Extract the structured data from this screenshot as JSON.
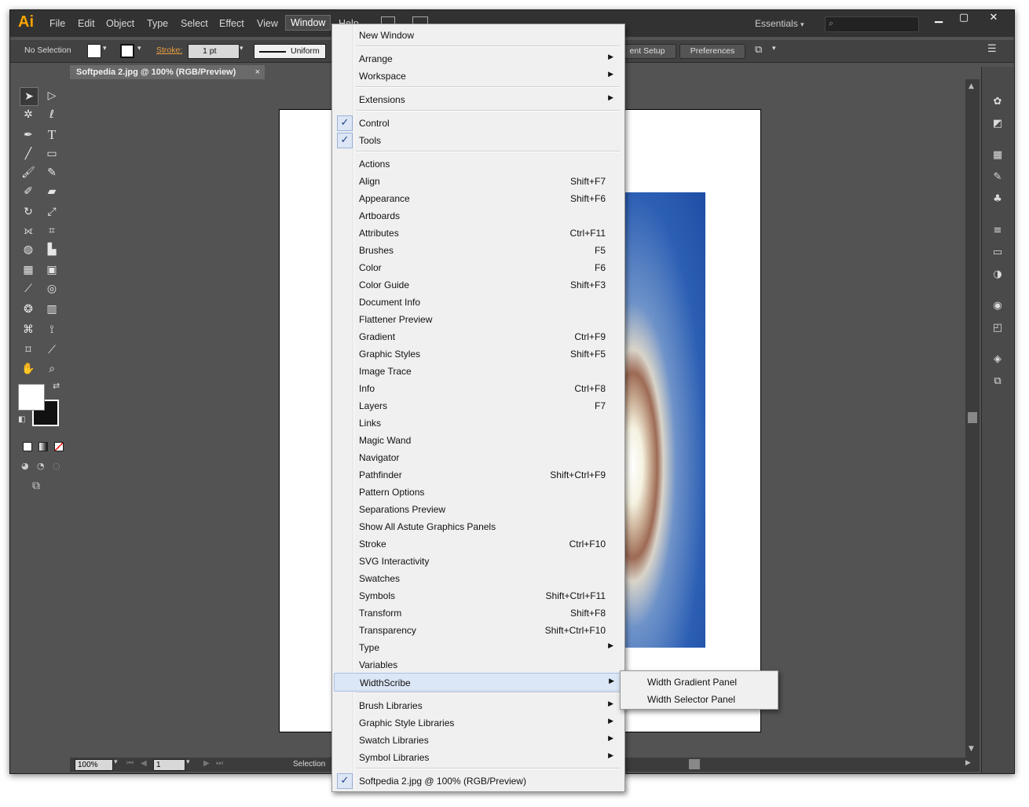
{
  "menubar": {
    "logo": "Ai",
    "items": [
      "File",
      "Edit",
      "Object",
      "Type",
      "Select",
      "Effect",
      "View",
      "Window",
      "Help"
    ],
    "workspace": "Essentials",
    "workspace_arrow": "▾"
  },
  "window_controls": {
    "minimize": "▁",
    "maximize": "▢",
    "close": "✕"
  },
  "control": {
    "selection": "No Selection",
    "stroke_label": "Stroke:",
    "stroke_value": "1 pt",
    "profile": "Uniform",
    "doc_setup": "ent Setup",
    "preferences": "Preferences"
  },
  "document": {
    "tab": "Softpedia 2.jpg @ 100% (RGB/Preview)",
    "tab_close": "×"
  },
  "status": {
    "zoom": "100%",
    "page": "1",
    "tool": "Selection"
  },
  "window_menu": {
    "items": [
      {
        "label": "New Window"
      },
      {
        "label": "Arrange",
        "arrow": "▶"
      },
      {
        "label": "Workspace",
        "arrow": "▶"
      },
      {
        "label": "Extensions",
        "arrow": "▶"
      },
      {
        "label": "Control",
        "check": "✓"
      },
      {
        "label": "Tools",
        "check": "✓"
      },
      {
        "label": "Actions"
      },
      {
        "label": "Align",
        "shortcut": "Shift+F7"
      },
      {
        "label": "Appearance",
        "shortcut": "Shift+F6"
      },
      {
        "label": "Artboards"
      },
      {
        "label": "Attributes",
        "shortcut": "Ctrl+F11"
      },
      {
        "label": "Brushes",
        "shortcut": "F5"
      },
      {
        "label": "Color",
        "shortcut": "F6"
      },
      {
        "label": "Color Guide",
        "shortcut": "Shift+F3"
      },
      {
        "label": "Document Info"
      },
      {
        "label": "Flattener Preview"
      },
      {
        "label": "Gradient",
        "shortcut": "Ctrl+F9"
      },
      {
        "label": "Graphic Styles",
        "shortcut": "Shift+F5"
      },
      {
        "label": "Image Trace"
      },
      {
        "label": "Info",
        "shortcut": "Ctrl+F8"
      },
      {
        "label": "Layers",
        "shortcut": "F7"
      },
      {
        "label": "Links"
      },
      {
        "label": "Magic Wand"
      },
      {
        "label": "Navigator"
      },
      {
        "label": "Pathfinder",
        "shortcut": "Shift+Ctrl+F9"
      },
      {
        "label": "Pattern Options"
      },
      {
        "label": "Separations Preview"
      },
      {
        "label": "Show All Astute Graphics Panels"
      },
      {
        "label": "Stroke",
        "shortcut": "Ctrl+F10"
      },
      {
        "label": "SVG Interactivity"
      },
      {
        "label": "Swatches"
      },
      {
        "label": "Symbols",
        "shortcut": "Shift+Ctrl+F11"
      },
      {
        "label": "Transform",
        "shortcut": "Shift+F8"
      },
      {
        "label": "Transparency",
        "shortcut": "Shift+Ctrl+F10"
      },
      {
        "label": "Type",
        "arrow": "▶"
      },
      {
        "label": "Variables"
      },
      {
        "label": "WidthScribe",
        "arrow": "▶",
        "highlighted": true
      },
      {
        "label": "Brush Libraries",
        "arrow": "▶"
      },
      {
        "label": "Graphic Style Libraries",
        "arrow": "▶"
      },
      {
        "label": "Swatch Libraries",
        "arrow": "▶"
      },
      {
        "label": "Symbol Libraries",
        "arrow": "▶"
      },
      {
        "label": "Softpedia 2.jpg @ 100% (RGB/Preview)",
        "check": "✓"
      }
    ]
  },
  "widthscribe_submenu": {
    "items": [
      "Width Gradient Panel",
      "Width Selector Panel"
    ]
  },
  "icons": {
    "tools": [
      "selection-icon",
      "direct-selection-icon",
      "magic-wand-icon",
      "lasso-icon",
      "pen-icon",
      "type-icon",
      "line-icon",
      "rectangle-icon",
      "paintbrush-icon",
      "pencil-icon",
      "blob-brush-icon",
      "eraser-icon",
      "rotate-icon",
      "scale-icon",
      "width-icon",
      "free-transform-icon",
      "shape-builder-icon",
      "perspective-grid-icon",
      "mesh-icon",
      "gradient-icon",
      "eyedropper-icon",
      "blend-icon",
      "symbol-sprayer-icon",
      "column-graph-icon",
      "artboard-icon",
      "slice-icon",
      "crop-icon",
      "knife-icon",
      "hand-icon",
      "zoom-icon"
    ],
    "dock": [
      "color-icon",
      "color-guide-icon",
      "swatches-icon",
      "brushes-icon",
      "symbols-icon",
      "stroke-icon",
      "gradient-icon",
      "transparency-icon",
      "appearance-icon",
      "graphic-styles-icon",
      "layers-icon",
      "artboards-icon"
    ]
  }
}
